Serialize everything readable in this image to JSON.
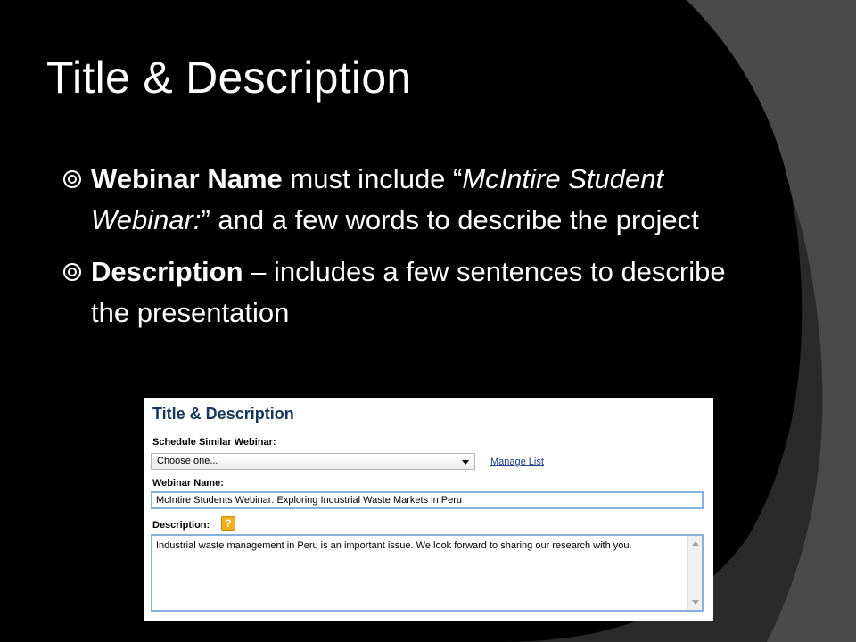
{
  "slide": {
    "title": "Title & Description",
    "bullets": [
      {
        "bold": "Webinar Name",
        "text1": " must include “",
        "italic": "McIntire Student Webinar:",
        "text2": "” and a few words to describe the project"
      },
      {
        "bold": "Description",
        "text1": " – includes a few sentences to describe the presentation"
      }
    ]
  },
  "form": {
    "title": "Title & Description",
    "schedule_label": "Schedule Similar Webinar:",
    "schedule_value": "Choose one...",
    "manage_link": "Manage List",
    "webinar_name_label": "Webinar Name:",
    "webinar_name_value": "McIntire Students Webinar: Exploring Industrial Waste Markets in Peru",
    "description_label": "Description:",
    "help_icon_glyph": "?",
    "description_value": "Industrial waste management in Peru is an important issue.  We look forward to sharing our research with you."
  },
  "colors": {
    "slide_background": "#000000",
    "panel_title": "#17375e",
    "input_border": "#86b1d9",
    "help_icon": "#f2b01e",
    "link": "#1f3f8f"
  },
  "icons": {
    "bullet": "target-bullet-icon",
    "help": "help-icon",
    "dropdown": "chevron-down-icon"
  }
}
